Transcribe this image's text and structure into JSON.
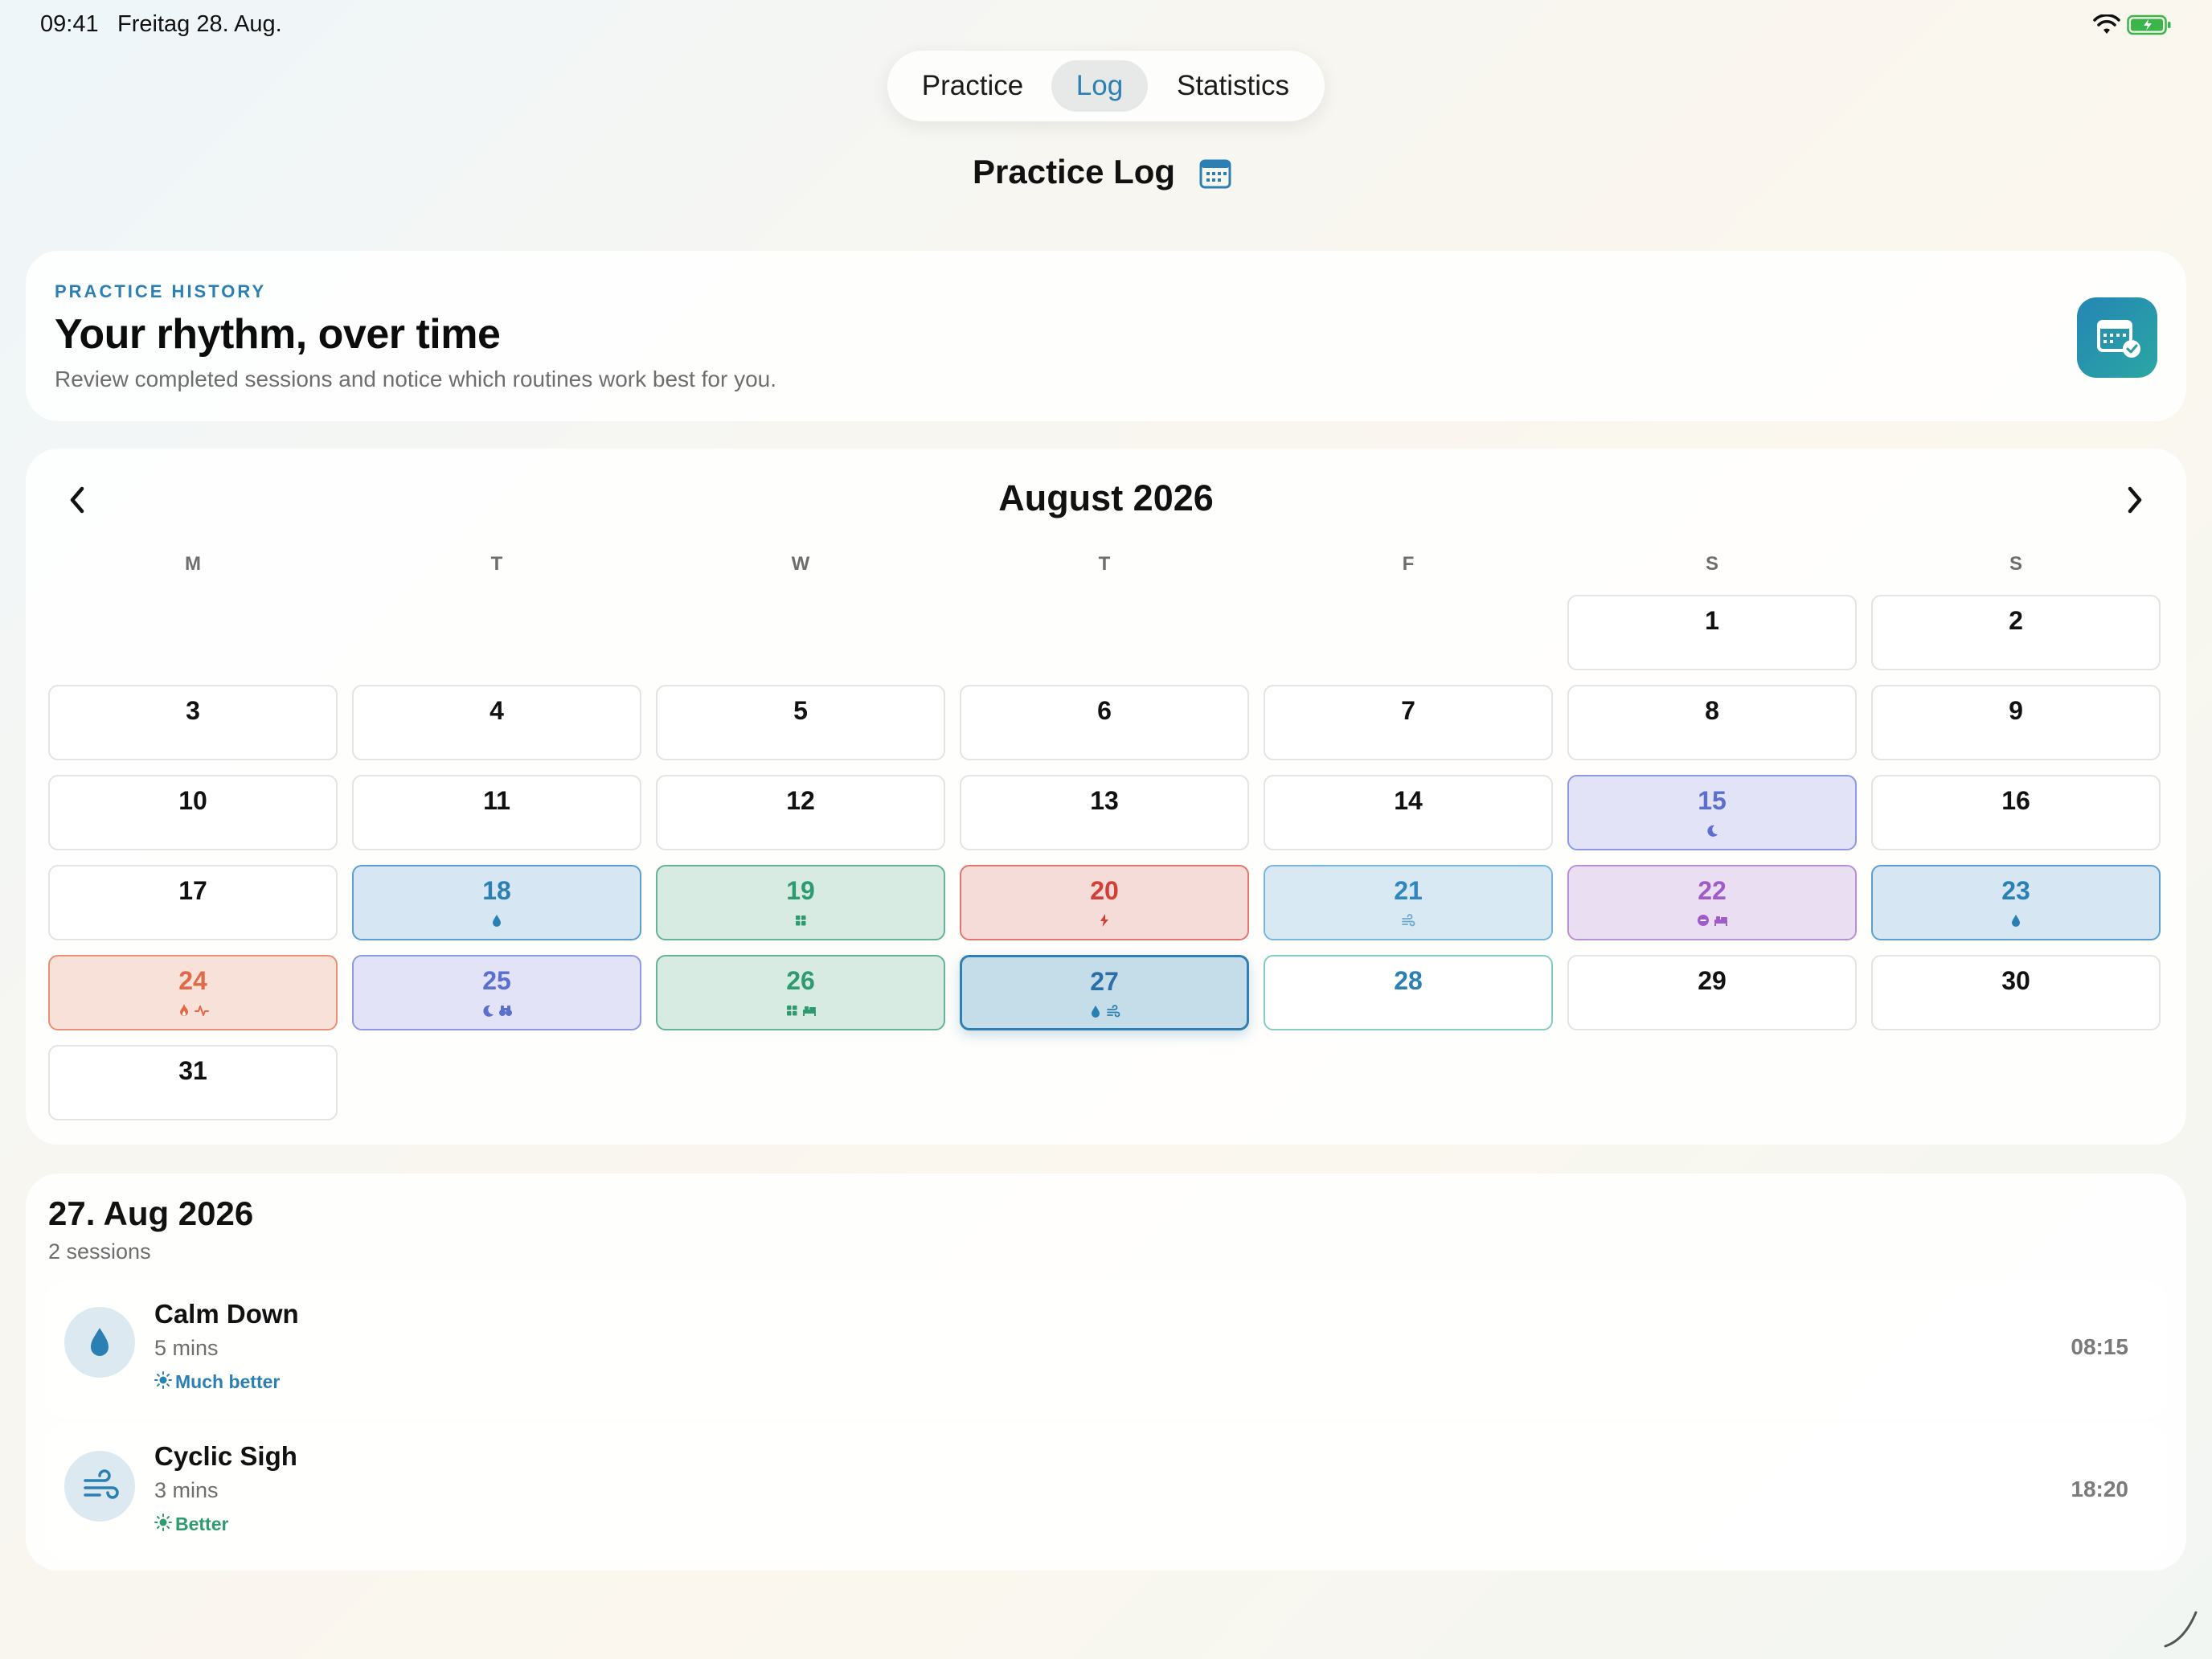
{
  "status_bar": {
    "time": "09:41",
    "date": "Freitag 28. Aug."
  },
  "tabs": [
    {
      "label": "Practice",
      "selected": false
    },
    {
      "label": "Log",
      "selected": true
    },
    {
      "label": "Statistics",
      "selected": false
    }
  ],
  "page_title": "Practice Log",
  "hero": {
    "eyebrow": "PRACTICE HISTORY",
    "title": "Your rhythm, over time",
    "subtitle": "Review completed sessions and notice which routines work best for you."
  },
  "calendar": {
    "month_label": "August 2026",
    "weekdays": [
      "M",
      "T",
      "W",
      "T",
      "F",
      "S",
      "S"
    ],
    "first_weekday_index": 5,
    "selected_day": 27,
    "today": 28,
    "colors": {
      "blue": "#2a7fb3",
      "indigo": "#5b6fcf",
      "green": "#2e9a6f",
      "red": "#d23f36",
      "sky": "#2f86c0",
      "purple": "#a15bc8",
      "orange": "#e06a47",
      "teal": "#2aa7a3"
    },
    "days": [
      {
        "d": 1
      },
      {
        "d": 2
      },
      {
        "d": 3
      },
      {
        "d": 4
      },
      {
        "d": 5
      },
      {
        "d": 6
      },
      {
        "d": 7
      },
      {
        "d": 8
      },
      {
        "d": 9
      },
      {
        "d": 10
      },
      {
        "d": 11
      },
      {
        "d": 12
      },
      {
        "d": 13
      },
      {
        "d": 14
      },
      {
        "d": 15,
        "theme": "indigo",
        "icons": [
          "moon-icon"
        ]
      },
      {
        "d": 16
      },
      {
        "d": 17
      },
      {
        "d": 18,
        "theme": "blue",
        "icons": [
          "drop-icon"
        ]
      },
      {
        "d": 19,
        "theme": "green",
        "icons": [
          "grid-icon"
        ]
      },
      {
        "d": 20,
        "theme": "red",
        "icons": [
          "bolt-icon"
        ]
      },
      {
        "d": 21,
        "theme": "sky",
        "icons": [
          "wind-icon"
        ]
      },
      {
        "d": 22,
        "theme": "purple",
        "icons": [
          "circle-icon",
          "bed-icon"
        ]
      },
      {
        "d": 23,
        "theme": "blue",
        "icons": [
          "drop-icon"
        ]
      },
      {
        "d": 24,
        "theme": "orange",
        "icons": [
          "flame-icon",
          "pulse-icon"
        ]
      },
      {
        "d": 25,
        "theme": "indigo",
        "icons": [
          "moon-icon",
          "binoculars-icon"
        ]
      },
      {
        "d": 26,
        "theme": "green",
        "icons": [
          "grid-icon",
          "bed-icon"
        ]
      },
      {
        "d": 27,
        "theme": "selected",
        "icons": [
          "drop-icon",
          "wind-icon"
        ]
      },
      {
        "d": 28,
        "theme": "today"
      },
      {
        "d": 29
      },
      {
        "d": 30
      },
      {
        "d": 31
      }
    ]
  },
  "detail": {
    "date": "27. Aug 2026",
    "count": "2 sessions",
    "sessions": [
      {
        "name": "Calm Down",
        "duration": "5 mins",
        "mood": "Much better",
        "mood_color": "#2a7fb3",
        "time": "08:15",
        "icon": "drop-icon"
      },
      {
        "name": "Cyclic Sigh",
        "duration": "3 mins",
        "mood": "Better",
        "mood_color": "#2e9a6f",
        "time": "18:20",
        "icon": "wind-icon"
      }
    ]
  }
}
